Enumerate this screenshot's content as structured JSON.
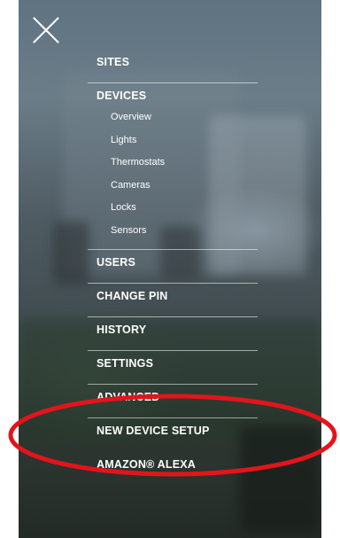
{
  "menu": {
    "sites": "SITES",
    "devices": {
      "label": "DEVICES",
      "items": [
        "Overview",
        "Lights",
        "Thermostats",
        "Cameras",
        "Locks",
        "Sensors"
      ]
    },
    "users": "USERS",
    "change_pin": "CHANGE PIN",
    "history": "HISTORY",
    "settings": "SETTINGS",
    "advanced": "ADVANCED",
    "new_device_setup": "NEW DEVICE SETUP",
    "amazon_alexa": "AMAZON® ALEXA"
  },
  "colors": {
    "highlight_ring": "#e3141b",
    "menu_text": "#ffffff"
  },
  "icons": {
    "close": "close-icon"
  }
}
